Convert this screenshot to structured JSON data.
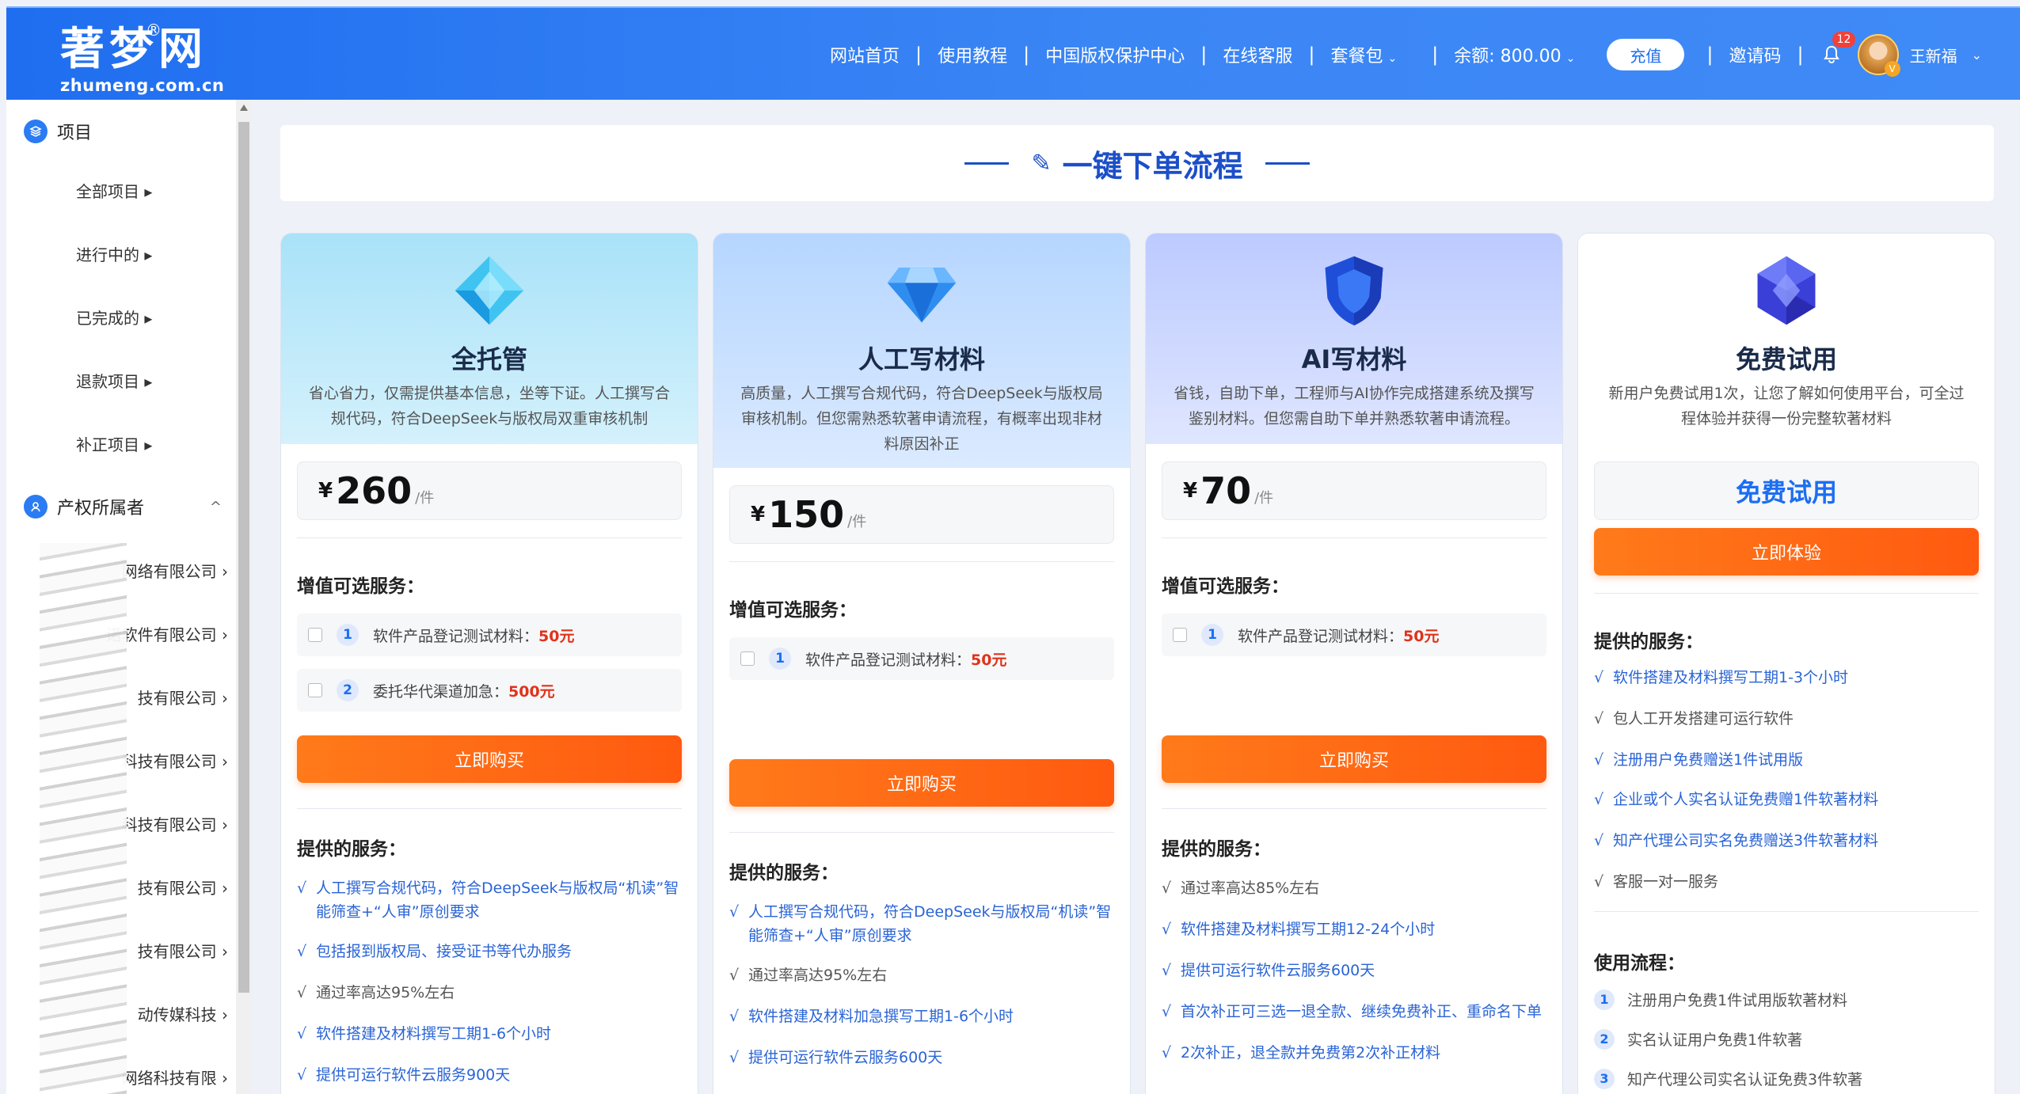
{
  "header": {
    "logo_cn": "著梦网",
    "logo_reg": "®",
    "logo_en": "zhumeng.com.cn",
    "nav": [
      "网站首页",
      "使用教程",
      "中国版权保护中心",
      "在线客服",
      "套餐包"
    ],
    "balance": "余额: 800.00",
    "recharge": "充值",
    "invite": "邀请码",
    "notify_count": "12",
    "username": "王新福",
    "caret": "⌄"
  },
  "sidebar": {
    "projects_title": "项目",
    "project_items": [
      "全部项目 ▸",
      "进行中的 ▸",
      "已完成的 ▸",
      "退款项目 ▸",
      "补正项目 ▸"
    ],
    "owners_title": "产权所属者",
    "owners_caret": "^",
    "owners": [
      "网络有限公司 ›",
      "诺软件有限公司 ›",
      "技有限公司 ›",
      "科技有限公司 ›",
      "科技有限公司 ›",
      "技有限公司 ›",
      "技有限公司 ›",
      "动传媒科技 ›",
      "网络科技有限 ›"
    ]
  },
  "main": {
    "title": "一键下单流程",
    "pencil": "✎"
  },
  "cards": [
    {
      "name": "全托管",
      "desc": "省心省力，仅需提供基本信息，坐等下证。人工撰写合规代码，符合DeepSeek与版权局双重审核机制",
      "price_symbol": "¥",
      "price": "260",
      "unit": "/件",
      "options_label": "增值可选服务：",
      "options": [
        {
          "num": "1",
          "text": "软件产品登记测试材料：",
          "price": "50元"
        },
        {
          "num": "2",
          "text": "委托华代渠道加急：",
          "price": "500元"
        }
      ],
      "buy": "立即购买",
      "services_label": "提供的服务：",
      "services": [
        {
          "text": "人工撰写合规代码，符合DeepSeek与版权局“机读”智能筛查+“人审”原创要求",
          "blue": true
        },
        {
          "text": "包括报到版权局、接受证书等代办服务",
          "blue": true
        },
        {
          "text": "通过率高达95%左右",
          "blue": false
        },
        {
          "text": "软件搭建及材料撰写工期1-6个小时",
          "blue": true
        },
        {
          "text": "提供可运行软件云服务900天",
          "blue": true
        }
      ]
    },
    {
      "name": "人工写材料",
      "desc": "高质量，人工撰写合规代码，符合DeepSeek与版权局审核机制。但您需熟悉软著申请流程，有概率出现非材料原因补正",
      "price_symbol": "¥",
      "price": "150",
      "unit": "/件",
      "options_label": "增值可选服务：",
      "options": [
        {
          "num": "1",
          "text": "软件产品登记测试材料：",
          "price": "50元"
        }
      ],
      "buy": "立即购买",
      "services_label": "提供的服务：",
      "services": [
        {
          "text": "人工撰写合规代码，符合DeepSeek与版权局“机读”智能筛查+“人审”原创要求",
          "blue": true
        },
        {
          "text": "通过率高达95%左右",
          "blue": false
        },
        {
          "text": "软件搭建及材料加急撰写工期1-6个小时",
          "blue": true
        },
        {
          "text": "提供可运行软件云服务600天",
          "blue": true
        }
      ]
    },
    {
      "name": "AI写材料",
      "desc": "省钱，自助下单，工程师与AI协作完成搭建系统及撰写鉴别材料。但您需自助下单并熟悉软著申请流程。",
      "price_symbol": "¥",
      "price": "70",
      "unit": "/件",
      "options_label": "增值可选服务：",
      "options": [
        {
          "num": "1",
          "text": "软件产品登记测试材料：",
          "price": "50元"
        }
      ],
      "buy": "立即购买",
      "services_label": "提供的服务：",
      "services": [
        {
          "text": "通过率高达85%左右",
          "blue": false
        },
        {
          "text": "软件搭建及材料撰写工期12-24个小时",
          "blue": true
        },
        {
          "text": "提供可运行软件云服务600天",
          "blue": true
        },
        {
          "text": "首次补正可三选一退全款、继续免费补正、重命名下单",
          "blue": true
        },
        {
          "text": "2次补正，退全款并免费第2次补正材料",
          "blue": true
        }
      ]
    },
    {
      "name": "免费试用",
      "desc": "新用户免费试用1次，让您了解如何使用平台，可全过程体验并获得一份完整软著材料",
      "free_title": "免费试用",
      "buy": "立即体验",
      "services_label": "提供的服务：",
      "services": [
        {
          "text": "软件搭建及材料撰写工期1-3个小时",
          "blue": true
        },
        {
          "text": "包人工开发搭建可运行软件",
          "blue": false
        },
        {
          "text": "注册用户免费赠送1件试用版",
          "blue": true
        },
        {
          "text": "企业或个人实名认证免费赠1件软著材料",
          "blue": true
        },
        {
          "text": "知产代理公司实名免费赠送3件软著材料",
          "blue": true
        },
        {
          "text": "客服一对一服务",
          "blue": false
        }
      ],
      "flow_label": "使用流程：",
      "flow": [
        {
          "num": "1",
          "text": "注册用户免费1件试用版软著材料"
        },
        {
          "num": "2",
          "text": "实名认证用户免费1件软著"
        },
        {
          "num": "3",
          "text": "知产代理公司实名认证免费3件软著"
        }
      ]
    }
  ],
  "colors": {
    "primary": "#1f6ef0",
    "accent": "#ff6a14",
    "price_red": "#e0331b"
  },
  "check_mark": "√"
}
